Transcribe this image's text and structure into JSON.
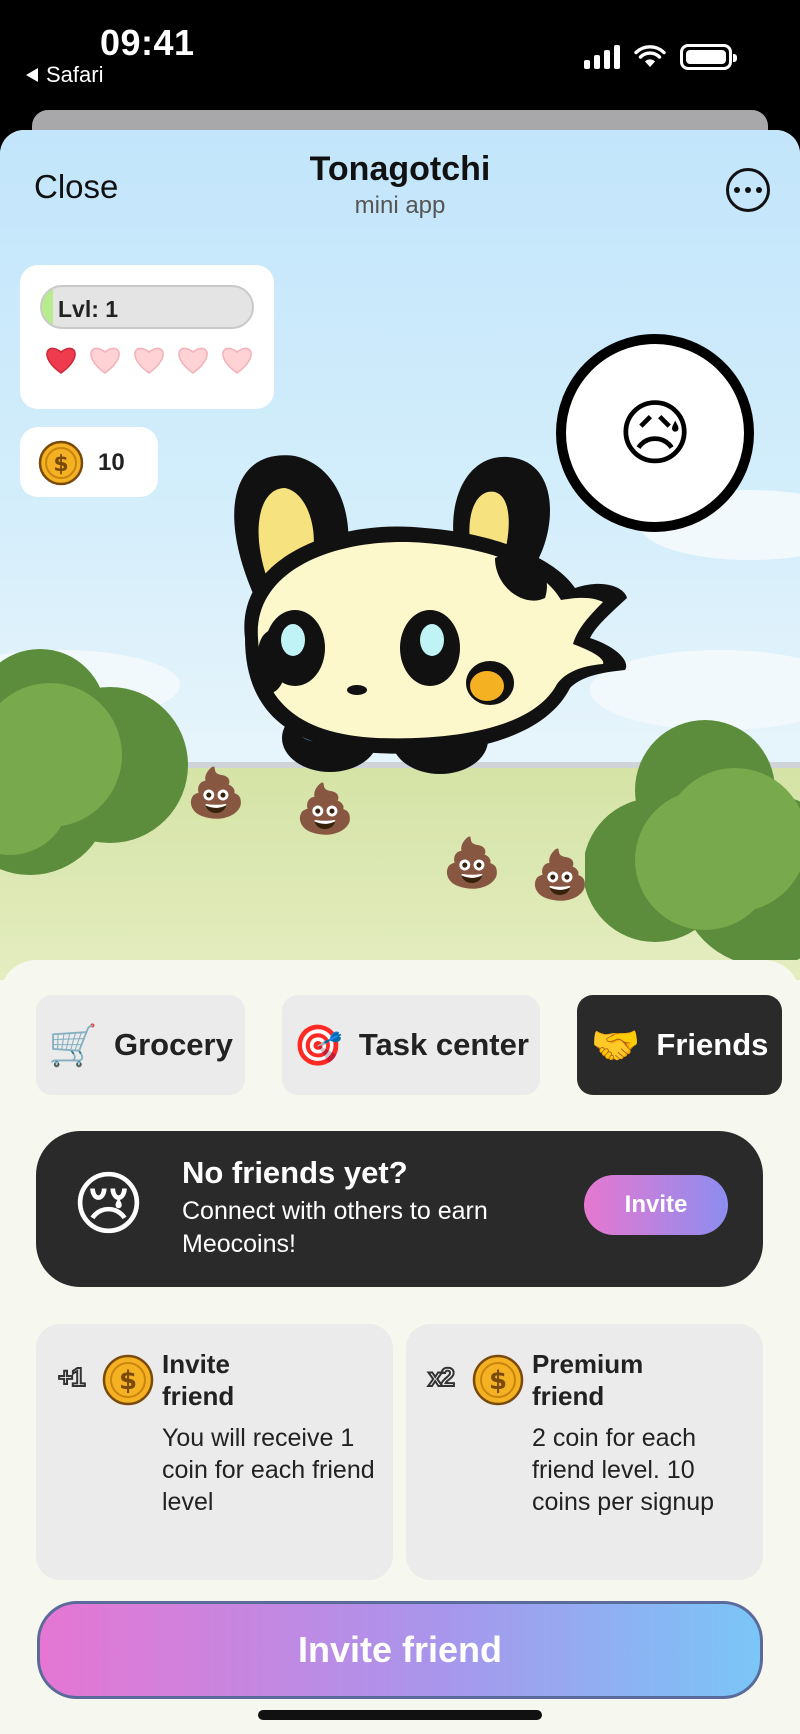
{
  "status_bar": {
    "time": "09:41",
    "back_label": "Safari"
  },
  "header": {
    "close_label": "Close",
    "title": "Tonagotchi",
    "subtitle": "mini app"
  },
  "stats": {
    "level_label": "Lvl: 1",
    "level_progress": 0.05,
    "hearts_total": 5,
    "hearts_filled": 1,
    "coins": "10"
  },
  "pet": {
    "mood_emoji": "😥",
    "poop_emoji": "💩"
  },
  "tabs": [
    {
      "icon": "🛒",
      "label": "Grocery",
      "active": false
    },
    {
      "icon": "🎯",
      "label": "Task center",
      "active": false
    },
    {
      "icon": "🤝",
      "label": "Friends",
      "active": true
    }
  ],
  "no_friends": {
    "emoji": "😢",
    "title": "No friends yet?",
    "description": "Connect with others to earn Meocoins!",
    "button": "Invite"
  },
  "info_cards": [
    {
      "multiplier": "+1",
      "title": "Invite friend",
      "description": "You will receive 1 coin for each friend level"
    },
    {
      "multiplier": "x2",
      "title": "Premium friend",
      "description": "2 coin for each friend level. 10 coins per signup"
    }
  ],
  "cta": {
    "label": "Invite friend"
  },
  "colors": {
    "heart": "#ee3b4e",
    "heart_empty": "#ffd2d6",
    "coin": "#f4b223",
    "dark": "#2a2a2a"
  }
}
